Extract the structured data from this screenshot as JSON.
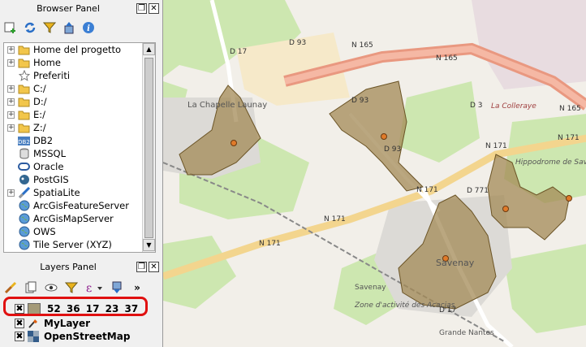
{
  "browser_panel": {
    "title": "Browser Panel",
    "items": [
      {
        "label": "Home del progetto",
        "icon": "folder-icon",
        "expandable": true
      },
      {
        "label": "Home",
        "icon": "folder-icon",
        "expandable": true
      },
      {
        "label": "Preferiti",
        "icon": "star-icon",
        "expandable": false
      },
      {
        "label": "C:/",
        "icon": "folder-icon",
        "expandable": true
      },
      {
        "label": "D:/",
        "icon": "folder-icon",
        "expandable": true
      },
      {
        "label": "E:/",
        "icon": "folder-icon",
        "expandable": true
      },
      {
        "label": "Z:/",
        "icon": "folder-icon",
        "expandable": true
      },
      {
        "label": "DB2",
        "icon": "db2-icon",
        "expandable": false
      },
      {
        "label": "MSSQL",
        "icon": "mssql-icon",
        "expandable": false
      },
      {
        "label": "Oracle",
        "icon": "oracle-icon",
        "expandable": false
      },
      {
        "label": "PostGIS",
        "icon": "postgis-icon",
        "expandable": false
      },
      {
        "label": "SpatiaLite",
        "icon": "spatialite-icon",
        "expandable": true
      },
      {
        "label": "ArcGisFeatureServer",
        "icon": "globe-icon",
        "expandable": false
      },
      {
        "label": "ArcGisMapServer",
        "icon": "globe-icon",
        "expandable": false
      },
      {
        "label": "OWS",
        "icon": "globe-icon",
        "expandable": false
      },
      {
        "label": "Tile Server (XYZ)",
        "icon": "globe-icon",
        "expandable": false
      }
    ]
  },
  "layers_panel": {
    "title": "Layers Panel",
    "more_label": "»",
    "layers": [
      {
        "label": "52 36 17 23 37",
        "checked": "✖",
        "icon": "polygon-layer-swatch-icon"
      },
      {
        "label": "MyLayer",
        "checked": "✖",
        "icon": "vector-point-layer-icon"
      },
      {
        "label": "OpenStreetMap",
        "checked": "✖",
        "icon": "raster-tile-layer-icon"
      }
    ]
  },
  "map": {
    "road_labels": [
      "D 17",
      "D 93",
      "N 165",
      "N 165",
      "N 165",
      "D 3",
      "La Colleraye",
      "D 93",
      "D 93",
      "N 171",
      "N 171",
      "N 171",
      "N 171",
      "N 171",
      "D 771",
      "Hippodrome de Savenay",
      "Savenay",
      "Savenay",
      "Zone d'activité des Acacias",
      "D 17",
      "La Chapelle Launay",
      "Grande Nantes"
    ],
    "colors": {
      "background": "#f2efe9",
      "fields": "#cde7b0",
      "polygon_fill": "#a38a55",
      "polygon_stroke": "#6b5426",
      "motorway": "#e99880",
      "centroid": "#e07b2a"
    }
  }
}
